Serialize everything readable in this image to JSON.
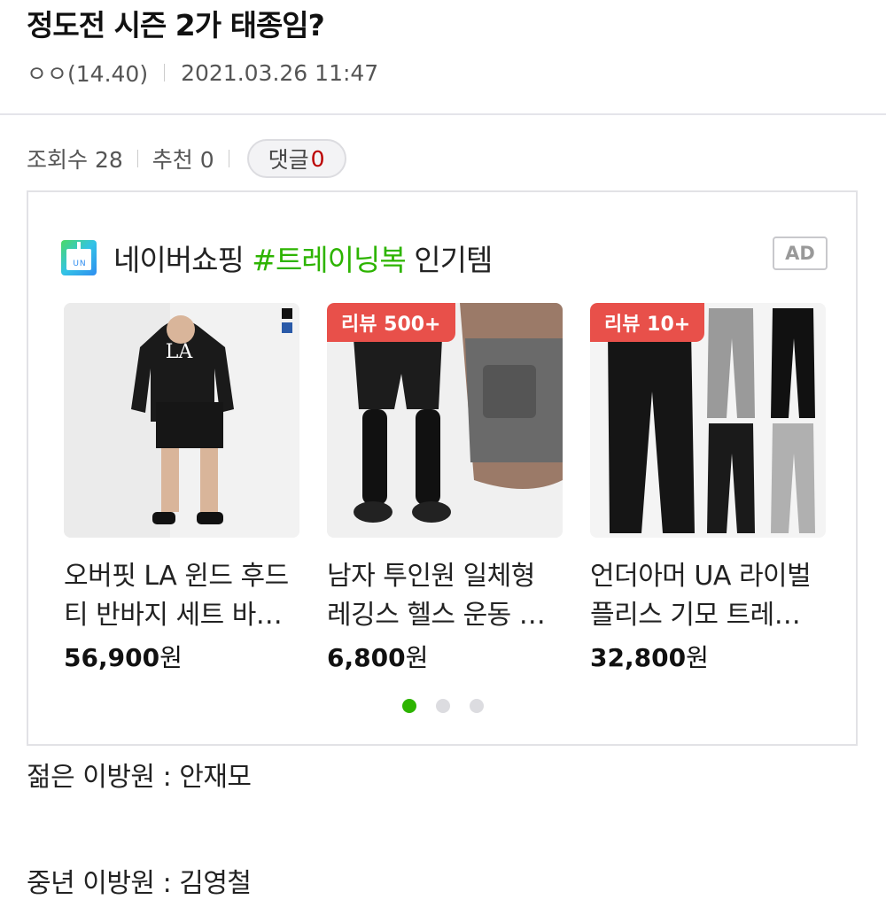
{
  "post": {
    "title": "정도전 시즌 2가 태종임?",
    "author": "ㅇㅇ(14.40)",
    "datetime": "2021.03.26 11:47",
    "views_label": "조회수 28",
    "likes_label": "추천 0",
    "comments_label": "댓글",
    "comments_count": "0"
  },
  "ad": {
    "header_prefix": "네이버쇼핑 ",
    "header_tag": "#트레이닝복",
    "header_suffix": " 인기템",
    "badge": "AD",
    "products": [
      {
        "name": "오버핏 LA 윈드 후드티 반바지 세트 바…",
        "price": "56,900",
        "currency": "원",
        "review_badge": ""
      },
      {
        "name": "남자 투인원 일체형 레깅스 헬스 운동 …",
        "price": "6,800",
        "currency": "원",
        "review_badge": "리뷰 500+"
      },
      {
        "name": "언더아머 UA 라이벌 플리스 기모 트레…",
        "price": "32,800",
        "currency": "원",
        "review_badge": "리뷰 10+"
      }
    ],
    "carousel_active_index": 0,
    "carousel_pages": 3
  },
  "content": {
    "line1": "젊은 이방원 : 안재모",
    "line2": "중년 이방원 : 김영철"
  },
  "colors": {
    "accent_green": "#2db400",
    "review_badge_red": "#e8504a",
    "comment_count_red": "#bb0000"
  }
}
